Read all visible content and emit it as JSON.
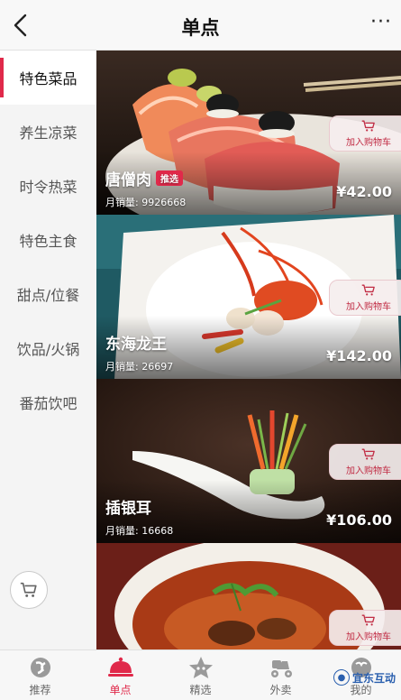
{
  "header": {
    "title": "单点",
    "more": "···"
  },
  "sidebar": {
    "items": [
      {
        "label": "特色菜品",
        "active": true
      },
      {
        "label": "养生凉菜",
        "active": false
      },
      {
        "label": "时令热菜",
        "active": false
      },
      {
        "label": "特色主食",
        "active": false
      },
      {
        "label": "甜点/位餐",
        "active": false
      },
      {
        "label": "饮品/火锅",
        "active": false
      },
      {
        "label": "番茄饮吧",
        "active": false
      }
    ]
  },
  "menu": {
    "add_cart_label": "加入购物车",
    "items": [
      {
        "name": "唐僧肉",
        "badge": "推选",
        "sales_label": "月销量:",
        "sales": "9926668",
        "price": "¥42.00"
      },
      {
        "name": "东海龙王",
        "sales_label": "月销量:",
        "sales": "26697",
        "price": "¥142.00"
      },
      {
        "name": "插银耳",
        "sales_label": "月销量:",
        "sales": "16668",
        "price": "¥106.00"
      },
      {
        "name": "",
        "sales_label": "",
        "sales": "",
        "price": ""
      }
    ]
  },
  "bottom_nav": {
    "tabs": [
      {
        "label": "推荐",
        "icon": "recommend-icon"
      },
      {
        "label": "单点",
        "icon": "cloche-icon",
        "active": true
      },
      {
        "label": "精选",
        "icon": "star-icon"
      },
      {
        "label": "外卖",
        "icon": "scooter-icon"
      },
      {
        "label": "我的",
        "icon": "user-icon"
      }
    ]
  },
  "watermark": {
    "text": "宜东互动"
  },
  "colors": {
    "accent": "#e0294a",
    "sidebar_bg": "#f4f4f4",
    "header_bg": "#f8f8f8"
  }
}
